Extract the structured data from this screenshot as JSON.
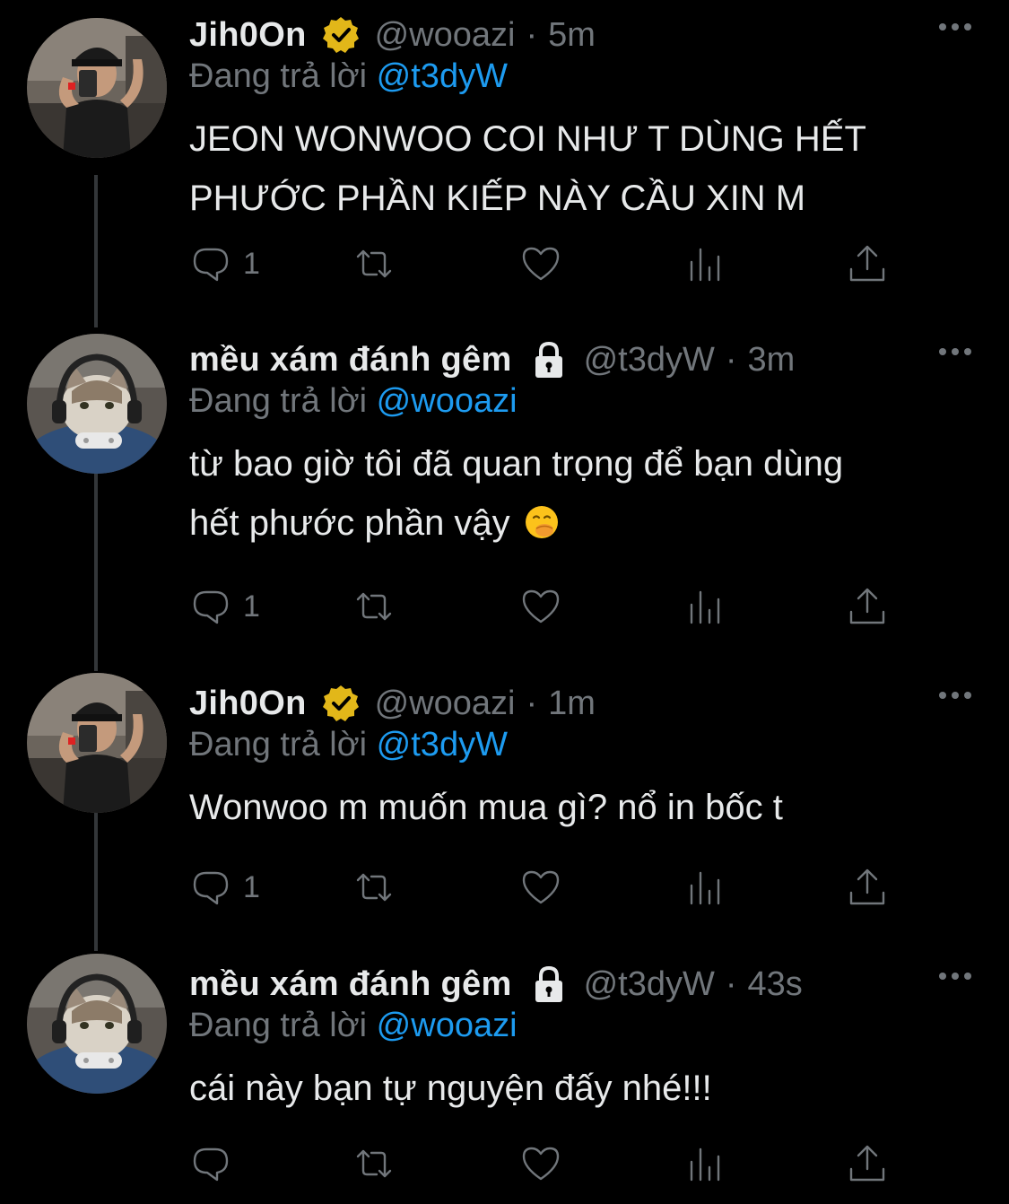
{
  "thread": {
    "tweets": [
      {
        "author": {
          "display_name": "Jih0On",
          "handle": "@wooazi",
          "verified": true,
          "protected": false,
          "avatar": "man-selfie-avatar"
        },
        "time": "5m",
        "reply_prefix": "Đang trả lời",
        "reply_to": "@t3dyW",
        "text_lines": [
          "JEON WONWOO COI NHƯ T DÙNG HẾT",
          "PHƯỚC PHẦN KIẾP NÀY CẦU XIN M"
        ],
        "emoji": "",
        "reply_count": "1"
      },
      {
        "author": {
          "display_name": "mều xám đánh gêm",
          "handle": "@t3dyW",
          "verified": false,
          "protected": true,
          "avatar": "cat-gamer-avatar"
        },
        "time": "3m",
        "reply_prefix": "Đang trả lời",
        "reply_to": "@wooazi",
        "text_lines": [
          "từ bao giờ tôi đã quan trọng để bạn dùng",
          "hết phước phần vậy"
        ],
        "emoji": "hand-over-mouth-emoji",
        "reply_count": "1"
      },
      {
        "author": {
          "display_name": "Jih0On",
          "handle": "@wooazi",
          "verified": true,
          "protected": false,
          "avatar": "man-selfie-avatar"
        },
        "time": "1m",
        "reply_prefix": "Đang trả lời",
        "reply_to": "@t3dyW",
        "text_lines": [
          "Wonwoo m muốn mua gì? nổ in bốc t"
        ],
        "emoji": "",
        "reply_count": "1"
      },
      {
        "author": {
          "display_name": "mều xám đánh gêm",
          "handle": "@t3dyW",
          "verified": false,
          "protected": true,
          "avatar": "cat-gamer-avatar"
        },
        "time": "43s",
        "reply_prefix": "Đang trả lời",
        "reply_to": "@wooazi",
        "text_lines": [
          "cái này bạn tự nguyện đấy nhé!!!"
        ],
        "emoji": "",
        "reply_count": ""
      }
    ]
  },
  "colors": {
    "background": "#000000",
    "primary_text": "#e7e9ea",
    "secondary_text": "#71767b",
    "link": "#1d9bf0",
    "verified_badge": "#e2b719",
    "thread_line": "#333639"
  },
  "icons": {
    "reply": "reply-icon",
    "retweet": "retweet-icon",
    "like": "heart-icon",
    "views": "views-icon",
    "share": "share-icon",
    "more": "more-icon",
    "verified": "verified-badge-icon",
    "protected": "lock-icon"
  }
}
